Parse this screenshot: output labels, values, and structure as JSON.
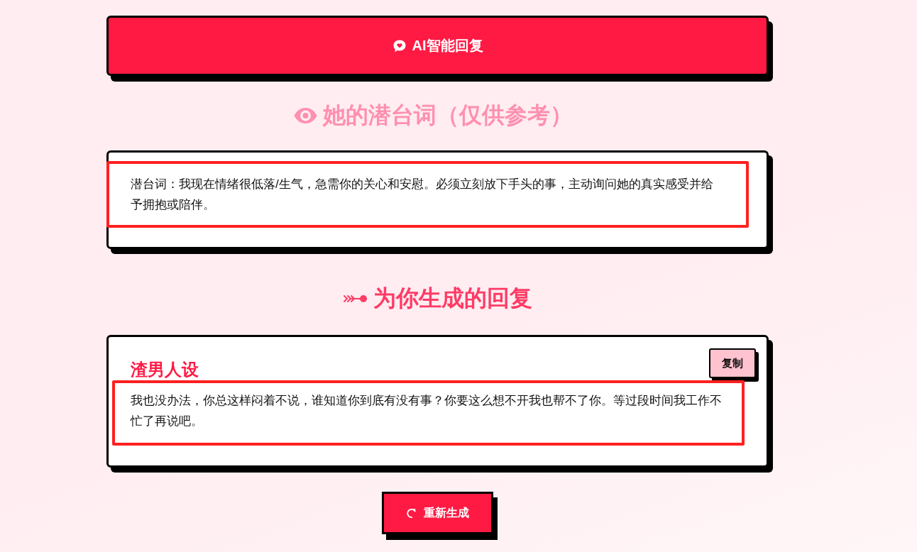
{
  "ai_reply_button": {
    "label": "AI智能回复"
  },
  "subtext_section": {
    "heading": "她的潜台词（仅供参考）",
    "text": "潜台词：我现在情绪很低落/生气，急需你的关心和安慰。必须立刻放下手头的事，主动询问她的真实感受并给予拥抱或陪伴。",
    "highlighted": true
  },
  "reply_section": {
    "heading": "为你生成的回复",
    "replies": [
      {
        "persona": "渣男人设",
        "copy_button": "复制",
        "text": "我也没办法，你总这样闷着不说，谁知道你到底有没有事？你要这么想不开我也帮不了你。等过段时间我工作不忙了再说吧。",
        "highlighted": true
      }
    ]
  },
  "regenerate_button": {
    "label": "重新生成"
  }
}
